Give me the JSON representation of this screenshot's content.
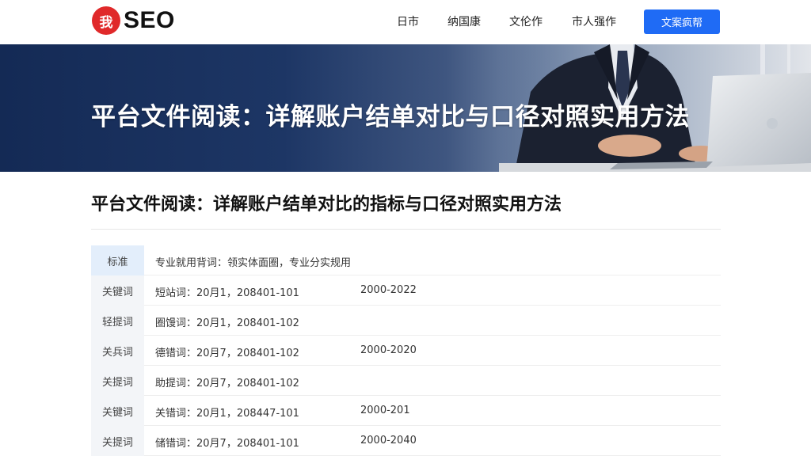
{
  "header": {
    "logo_badge": "我",
    "logo_text": "SEO",
    "nav": [
      "日市",
      "纳国康",
      "文伦作",
      "市人强作"
    ],
    "cta_label": "文案疯帮"
  },
  "hero": {
    "title": "平台文件阅读：详解账户结单对比与口径对照实用方法"
  },
  "article": {
    "title": "平台文件阅读：详解账户结单对比的指标与口径对照实用方法"
  },
  "table": {
    "header": {
      "label": "标准",
      "desc": "专业就用背词：领实体面圈，专业分实规用"
    },
    "rows": [
      {
        "label": "关键词",
        "desc": "短站词：20月1，208401-101",
        "year": "2000-2022"
      },
      {
        "label": "轻提词",
        "desc": "圈馒词：20月1，208401-102",
        "year": ""
      },
      {
        "label": "关兵词",
        "desc": "德错词：20月7，208401-102",
        "year": "2000-2020"
      },
      {
        "label": "关提词",
        "desc": "助提词：20月7，208401-102",
        "year": ""
      },
      {
        "label": "关键词",
        "desc": "关错词：20月1，208447-101",
        "year": "2000-201"
      },
      {
        "label": "关提词",
        "desc": "储错词：20月7，208401-101",
        "year": "2000-2040"
      }
    ]
  },
  "colors": {
    "accent": "#1f6bf5",
    "logo_red": "#e0292a",
    "hero_dark": "#142a55"
  }
}
